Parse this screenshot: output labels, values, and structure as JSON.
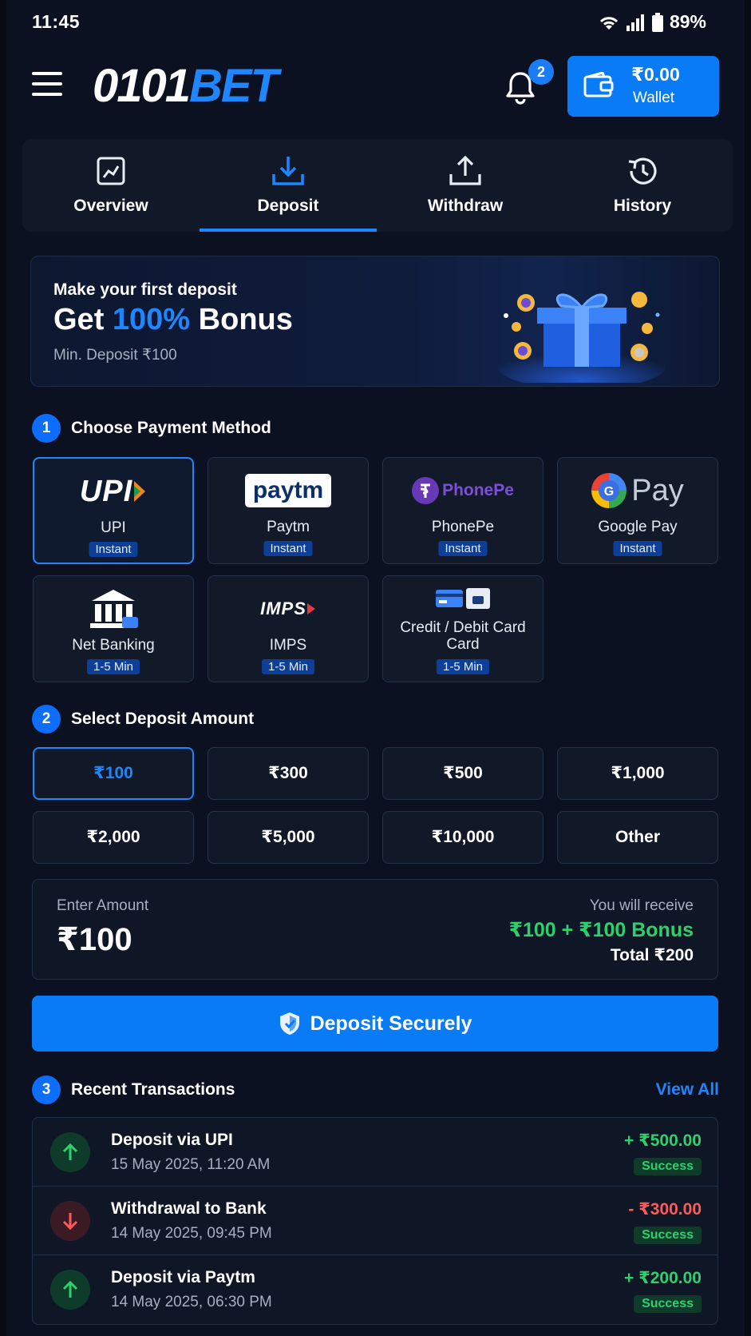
{
  "status_bar": {
    "time": "11:45",
    "battery": "89%"
  },
  "header": {
    "logo_part1": "0101",
    "logo_part2": "BET",
    "notification_count": "2",
    "wallet_amount": "₹0.00",
    "wallet_label": "Wallet"
  },
  "tabs": [
    {
      "label": "Overview",
      "icon": "overview-icon"
    },
    {
      "label": "Deposit",
      "icon": "download-icon"
    },
    {
      "label": "Withdraw",
      "icon": "upload-icon"
    },
    {
      "label": "History",
      "icon": "history-icon"
    }
  ],
  "active_tab": "Deposit",
  "banner": {
    "line1": "Make your first deposit",
    "line2_pre": "Get ",
    "line2_accent": "100%",
    "line2_post": " Bonus",
    "line3": "Min. Deposit ₹100"
  },
  "sections": {
    "payment": {
      "num": "1",
      "title": "Choose Payment Method"
    },
    "amount": {
      "num": "2",
      "title": "Select Deposit Amount"
    },
    "recent": {
      "num": "3",
      "title": "Recent Transactions",
      "view_all": "View All"
    }
  },
  "payment_methods": [
    {
      "name": "UPI",
      "badge": "Instant",
      "logo_text": "UPI"
    },
    {
      "name": "Paytm",
      "badge": "Instant",
      "logo_text": "paytm"
    },
    {
      "name": "PhonePe",
      "badge": "Instant",
      "logo_text": "PhonePe"
    },
    {
      "name": "Google Pay",
      "badge": "Instant",
      "logo_text": "Pay"
    },
    {
      "name": "Net Banking",
      "badge": "1-5 Min"
    },
    {
      "name": "IMPS",
      "badge": "1-5 Min",
      "logo_text": "IMPS"
    },
    {
      "name": "Credit / Debit Card Card",
      "badge": "1-5 Min"
    }
  ],
  "selected_payment": "UPI",
  "amounts": [
    "₹100",
    "₹300",
    "₹500",
    "₹1,000",
    "₹2,000",
    "₹5,000",
    "₹10,000",
    "Other"
  ],
  "selected_amount": "₹100",
  "amount_card": {
    "label": "Enter Amount",
    "value": "₹100",
    "receive_label": "You will receive",
    "receive_value": "₹100 + ₹100 Bonus",
    "total": "Total ₹200"
  },
  "deposit_button": "Deposit Securely",
  "transactions": [
    {
      "title": "Deposit via UPI",
      "date": "15 May 2025, 11:20 AM",
      "amount": "+ ₹500.00",
      "status": "Success",
      "direction": "in"
    },
    {
      "title": "Withdrawal to Bank",
      "date": "14 May 2025, 09:45 PM",
      "amount": "- ₹300.00",
      "status": "Success",
      "direction": "out"
    },
    {
      "title": "Deposit via Paytm",
      "date": "14 May 2025, 06:30 PM",
      "amount": "+ ₹200.00",
      "status": "Success",
      "direction": "in"
    }
  ],
  "colors": {
    "accent": "#1e86ff",
    "button": "#0a7bf7",
    "success": "#2ed06e",
    "danger": "#ff5a5a",
    "background": "#0b1120"
  }
}
